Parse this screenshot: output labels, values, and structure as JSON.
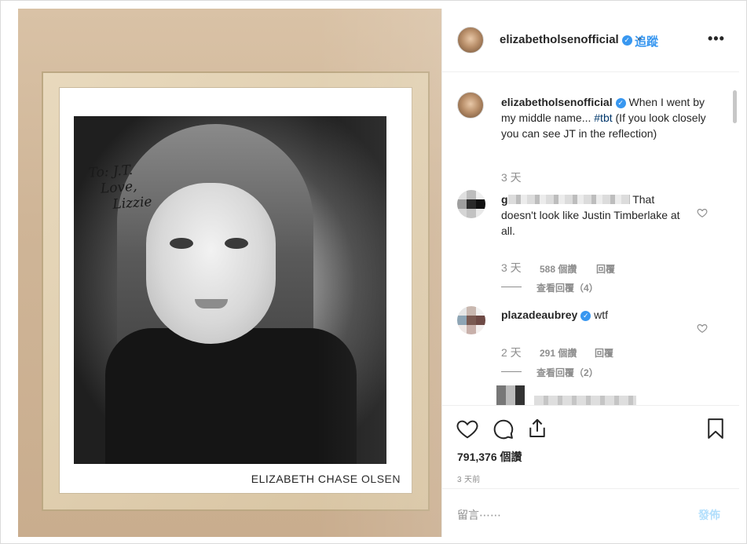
{
  "photo": {
    "signature_lines": [
      "To: J.T.",
      "Love,",
      "Lizzie"
    ],
    "printed_name": "ELIZABETH CHASE OLSEN"
  },
  "header": {
    "username": "elizabetholsenofficial",
    "verified_icon": "verified-badge-icon",
    "follow_separator": "•",
    "follow_label": "追蹤",
    "more_icon": "more-options-icon"
  },
  "caption": {
    "username": "elizabetholsenofficial",
    "text_before_tag": "When I went by my middle name... ",
    "hashtag": "#tbt",
    "text_after_tag": " (If you look closely you can see JT in the reflection)",
    "time": "3 天"
  },
  "comments": [
    {
      "username_visible": "g",
      "username_hidden": true,
      "text": "That doesn't look like Justin Timberlake at all.",
      "time": "3 天",
      "likes": "588 個讚",
      "reply": "回覆",
      "view_replies": "查看回覆（4）"
    },
    {
      "username": "plazadeaubrey",
      "verified": true,
      "text": "wtf",
      "time": "2 天",
      "likes": "291 個讚",
      "reply": "回覆",
      "view_replies": "查看回覆（2）"
    }
  ],
  "actions": {
    "icons": [
      "heart-icon",
      "comment-icon",
      "share-icon",
      "bookmark-icon"
    ],
    "likes_count": "791,376 個讚",
    "posted_ago": "3 天前"
  },
  "compose": {
    "placeholder": "留言⋯⋯",
    "post_label": "發佈"
  },
  "colors": {
    "accent": "#3897f0",
    "muted": "#8e8e8e",
    "text": "#262626",
    "post_disabled": "#b2dffc"
  }
}
